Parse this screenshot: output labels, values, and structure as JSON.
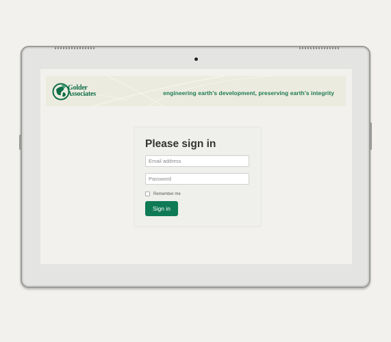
{
  "banner": {
    "logo_line1": "Golder",
    "logo_line2": "Associates",
    "tagline": "engineering earth’s development, preserving earth’s integrity",
    "brand_color": "#0e6e47"
  },
  "signin": {
    "heading": "Please sign in",
    "email_placeholder": "Email address",
    "password_placeholder": "Password",
    "email_value": "",
    "password_value": "",
    "remember_label": "Remember me",
    "remember_checked": false,
    "button_label": "Sign in",
    "button_color": "#0f7a56"
  },
  "device": {
    "camera": "camera-icon",
    "speakers": "speaker-grille-icon"
  }
}
